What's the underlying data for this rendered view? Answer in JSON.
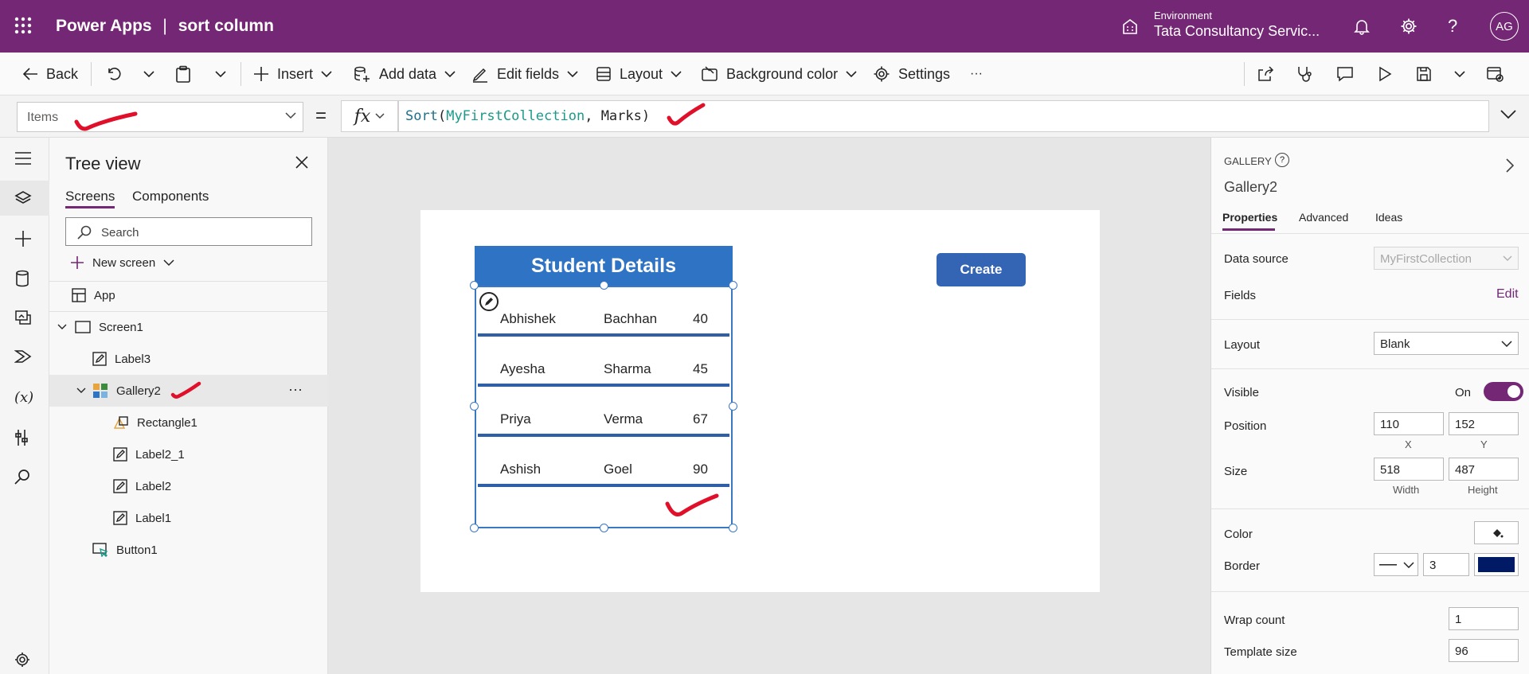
{
  "topbar": {
    "product": "Power Apps",
    "separator": "|",
    "app_name": "sort column",
    "env_label": "Environment",
    "env_name": "Tata Consultancy Servic...",
    "help_glyph": "?",
    "avatar": "AG"
  },
  "commandbar": {
    "back": "Back",
    "insert": "Insert",
    "add_data": "Add data",
    "edit_fields": "Edit fields",
    "layout": "Layout",
    "background_color": "Background color",
    "settings": "Settings",
    "more": "···"
  },
  "formulabar": {
    "property": "Items",
    "equals": "=",
    "fx": "fx",
    "formula": {
      "fn": "Sort",
      "open": "(",
      "collection": "MyFirstCollection",
      "comma": ", ",
      "arg": "Marks",
      "close": ")"
    }
  },
  "treeview": {
    "title": "Tree view",
    "tabs": [
      "Screens",
      "Components"
    ],
    "search_placeholder": "Search",
    "new_screen": "New screen",
    "items": {
      "app": "App",
      "screen1": "Screen1",
      "label3": "Label3",
      "gallery2": "Gallery2",
      "rectangle1": "Rectangle1",
      "label2_1": "Label2_1",
      "label2": "Label2",
      "label1": "Label1",
      "button1": "Button1"
    },
    "more": "···"
  },
  "canvas": {
    "header": "Student Details",
    "create_button": "Create",
    "rows": [
      {
        "first": "Abhishek",
        "last": "Bachhan",
        "marks": "40"
      },
      {
        "first": "Ayesha",
        "last": "Sharma",
        "marks": "45"
      },
      {
        "first": "Priya",
        "last": "Verma",
        "marks": "67"
      },
      {
        "first": "Ashish",
        "last": "Goel",
        "marks": "90"
      }
    ]
  },
  "properties": {
    "kind": "GALLERY",
    "help": "?",
    "name": "Gallery2",
    "tabs": [
      "Properties",
      "Advanced",
      "Ideas"
    ],
    "data_source_label": "Data source",
    "data_source": "MyFirstCollection",
    "fields_label": "Fields",
    "fields_edit": "Edit",
    "layout_label": "Layout",
    "layout": "Blank",
    "visible_label": "Visible",
    "visible_value": "On",
    "position_label": "Position",
    "position_x": "110",
    "position_y": "152",
    "x_label": "X",
    "y_label": "Y",
    "size_label": "Size",
    "size_width": "518",
    "size_height": "487",
    "width_label": "Width",
    "height_label": "Height",
    "color_label": "Color",
    "border_label": "Border",
    "border_width": "3",
    "border_color": "#001a66",
    "wrap_count_label": "Wrap count",
    "wrap_count": "1",
    "template_size_label": "Template size",
    "template_size": "96"
  },
  "colors": {
    "brand": "#742774",
    "gallery_header": "#2f73c4",
    "create_button": "#3465b5",
    "annotation": "#e0102a"
  }
}
